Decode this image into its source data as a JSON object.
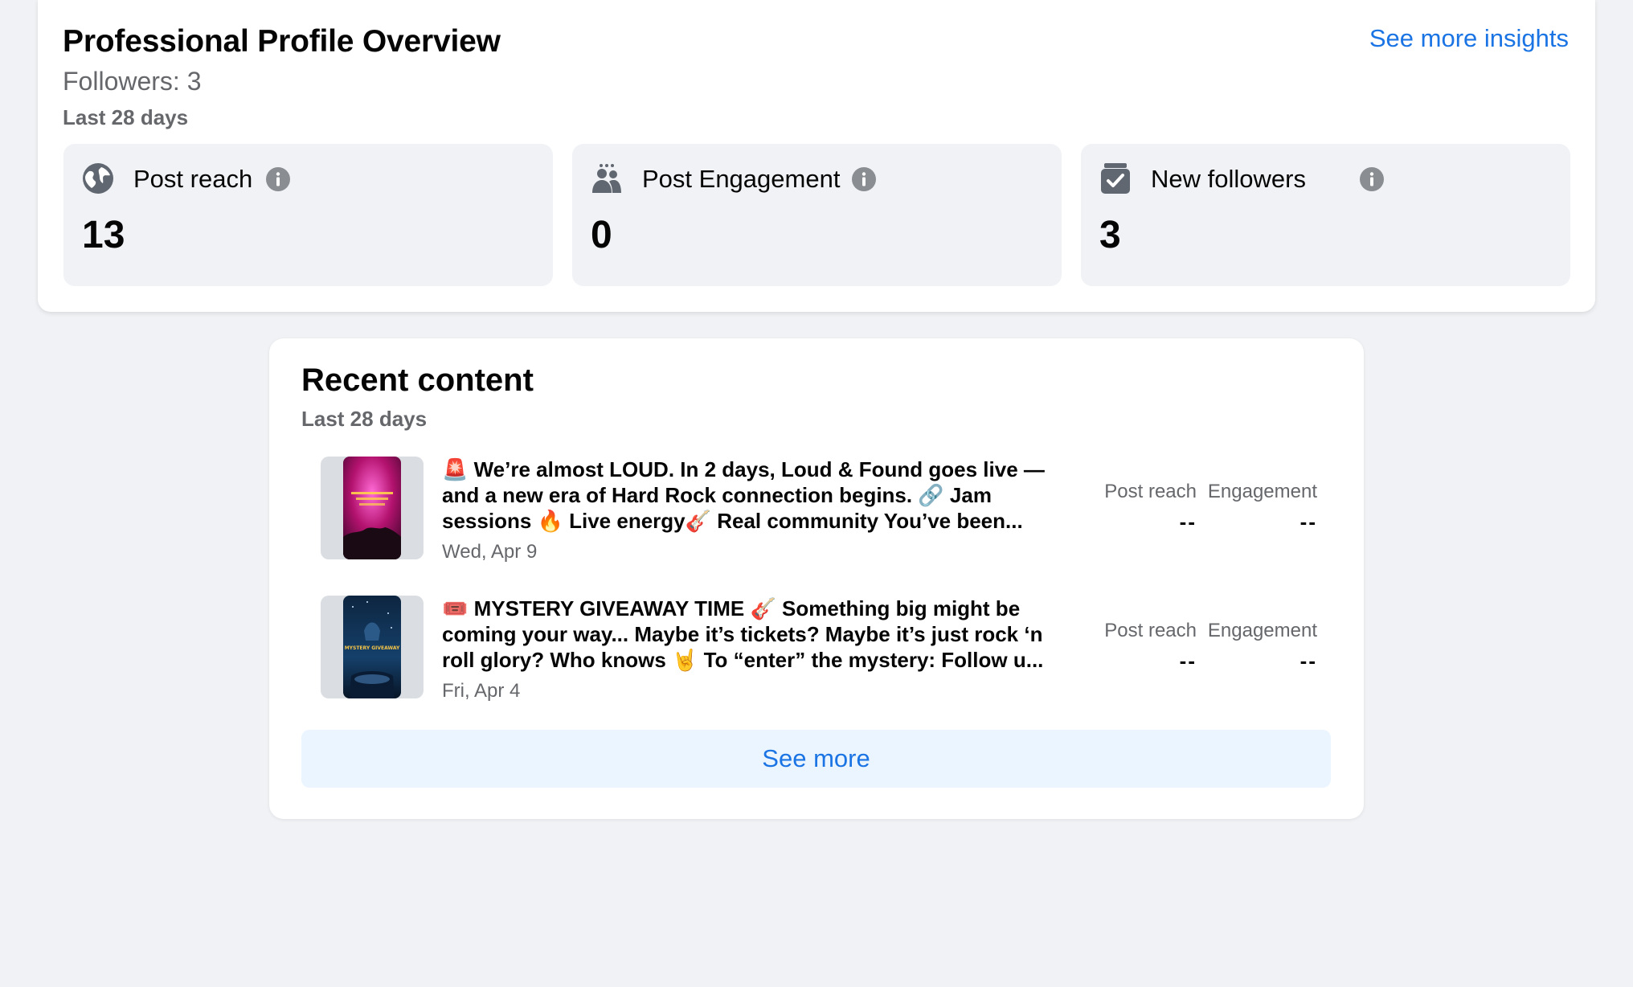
{
  "overview": {
    "title": "Professional Profile Overview",
    "followers": "Followers: 3",
    "period": "Last 28 days",
    "insights_link": "See more insights",
    "metrics": [
      {
        "label": "Post reach",
        "value": "13",
        "icon": "globe-icon"
      },
      {
        "label": "Post Engagement",
        "value": "0",
        "icon": "people-icon"
      },
      {
        "label": "New followers",
        "value": "3",
        "icon": "followers-badge-icon"
      }
    ]
  },
  "recent": {
    "title": "Recent content",
    "period": "Last 28 days",
    "posts": [
      {
        "text": "🚨 We’re almost LOUD. In 2 days, Loud & Found goes live — and a new era of Hard Rock connection begins. 🔗 Jam sessions 🔥 Live energy🎸 Real community You’ve been...",
        "date": "Wed, Apr 9",
        "reach_label": "Post reach",
        "reach_value": "--",
        "engagement_label": "Engagement",
        "engagement_value": "--"
      },
      {
        "text": "🎟️ MYSTERY GIVEAWAY TIME 🎸 Something big might be coming your way... Maybe it’s tickets? Maybe it’s just rock ‘n roll glory? Who knows 🤘 To “enter” the mystery: Follow u...",
        "date": "Fri, Apr 4",
        "reach_label": "Post reach",
        "reach_value": "--",
        "engagement_label": "Engagement",
        "engagement_value": "--",
        "thumb_text": "MYSTERY GIVEAWAY"
      }
    ],
    "see_more": "See more"
  },
  "colors": {
    "accent": "#1b74e4",
    "page_bg": "#f0f2f5",
    "muted_text": "#65676b",
    "button_bg": "#ebf5ff"
  }
}
